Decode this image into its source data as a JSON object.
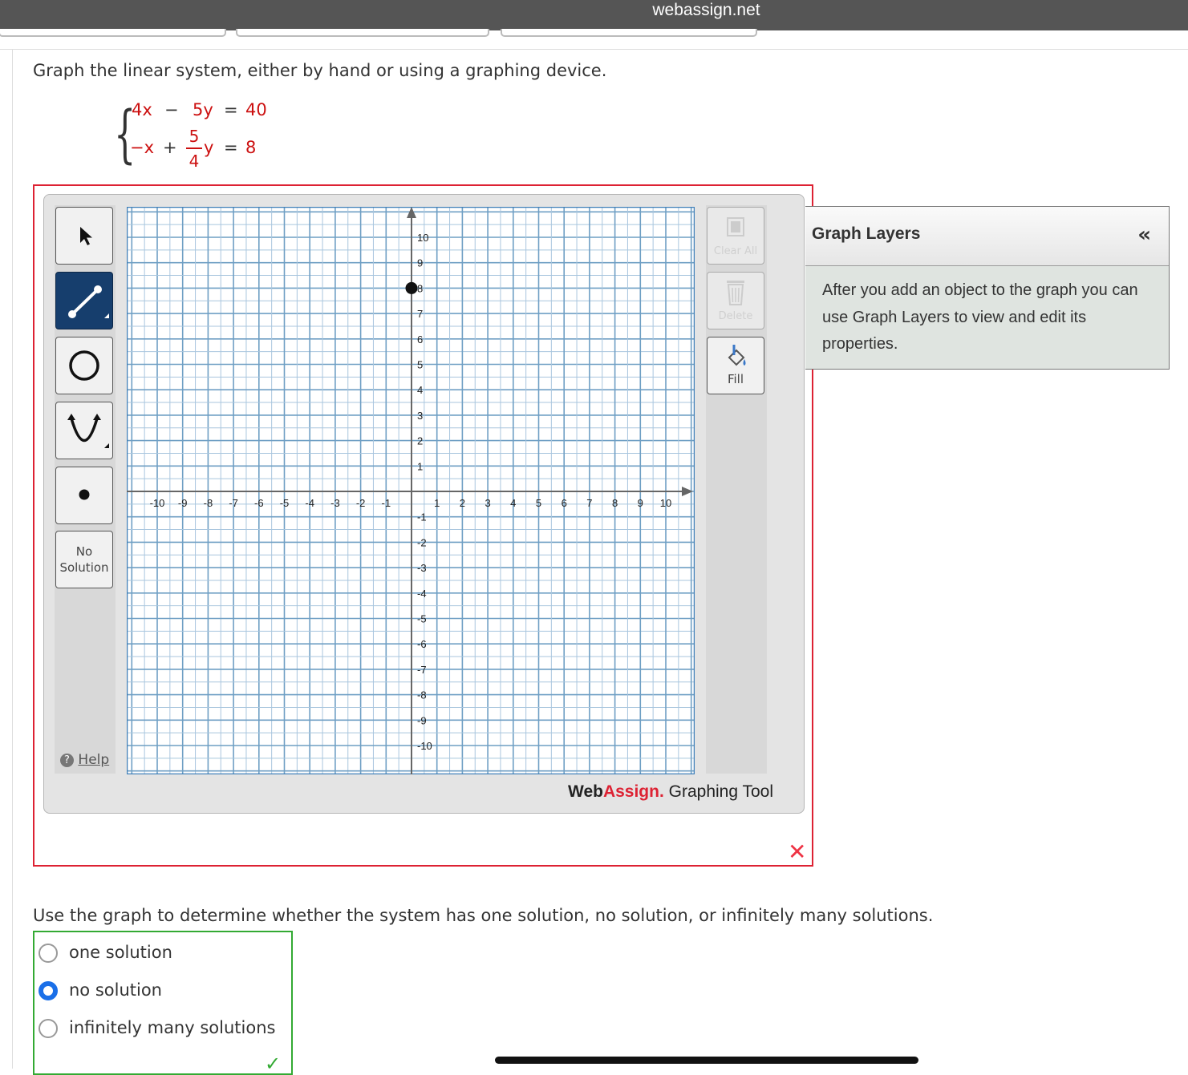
{
  "browser": {
    "url": "webassign.net"
  },
  "question": {
    "prompt": "Graph the linear system, either by hand or using a graphing device.",
    "equation1": {
      "a": "4x",
      "op": "−",
      "b": "5y",
      "eq": "=",
      "rhs": "40"
    },
    "equation2": {
      "a": "−x",
      "op": "+",
      "frac_num": "5",
      "frac_den": "4",
      "b": "y",
      "eq": "=",
      "rhs": "8"
    }
  },
  "graph_tool": {
    "tools": [
      {
        "name": "pointer-tool",
        "icon": "arrow-cursor-icon"
      },
      {
        "name": "line-tool",
        "icon": "line-segment-icon",
        "active": true
      },
      {
        "name": "circle-tool",
        "icon": "circle-icon"
      },
      {
        "name": "parabola-tool",
        "icon": "parabola-icon"
      },
      {
        "name": "point-tool",
        "icon": "dot-icon"
      }
    ],
    "no_solution_line1": "No",
    "no_solution_line2": "Solution",
    "help_label": "Help",
    "clear_all_label": "Clear All",
    "delete_label": "Delete",
    "fill_label": "Fill",
    "brand_web": "Web",
    "brand_assign": "Assign.",
    "brand_suffix": "Graphing Tool",
    "x_min": -10,
    "x_max": 10,
    "y_min": -10,
    "y_max": 10,
    "x_tick_labels": [
      "-10",
      "-9",
      "-8",
      "-7",
      "-6",
      "-5",
      "-4",
      "-3",
      "-2",
      "-1",
      "1",
      "2",
      "3",
      "4",
      "5",
      "6",
      "7",
      "8",
      "9",
      "10"
    ],
    "y_tick_labels": [
      "10",
      "9",
      "8",
      "7",
      "6",
      "5",
      "4",
      "3",
      "2",
      "1",
      "-1",
      "-2",
      "-3",
      "-4",
      "-5",
      "-6",
      "-7",
      "-8",
      "-9",
      "-10"
    ],
    "plotted_point": {
      "x": 0,
      "y": 8
    },
    "result_icon": "red-x-icon",
    "result_mark": "✕"
  },
  "graph_layers": {
    "title": "Graph Layers",
    "collapse": "«",
    "message": "After you add an object to the graph you can use Graph Layers to view and edit its properties."
  },
  "question2": {
    "prompt": "Use the graph to determine whether the system has one solution, no solution, or infinitely many solutions.",
    "options": [
      {
        "label": "one solution",
        "selected": false
      },
      {
        "label": "no solution",
        "selected": true
      },
      {
        "label": "infinitely many solutions",
        "selected": false
      }
    ],
    "result_icon": "green-check-icon",
    "result_mark": "✓"
  },
  "colors": {
    "accent_red": "#cc1010",
    "selected_radio": "#1a6fe8",
    "correct_green": "#33aa33",
    "grid_line": "#6f9fc4"
  }
}
